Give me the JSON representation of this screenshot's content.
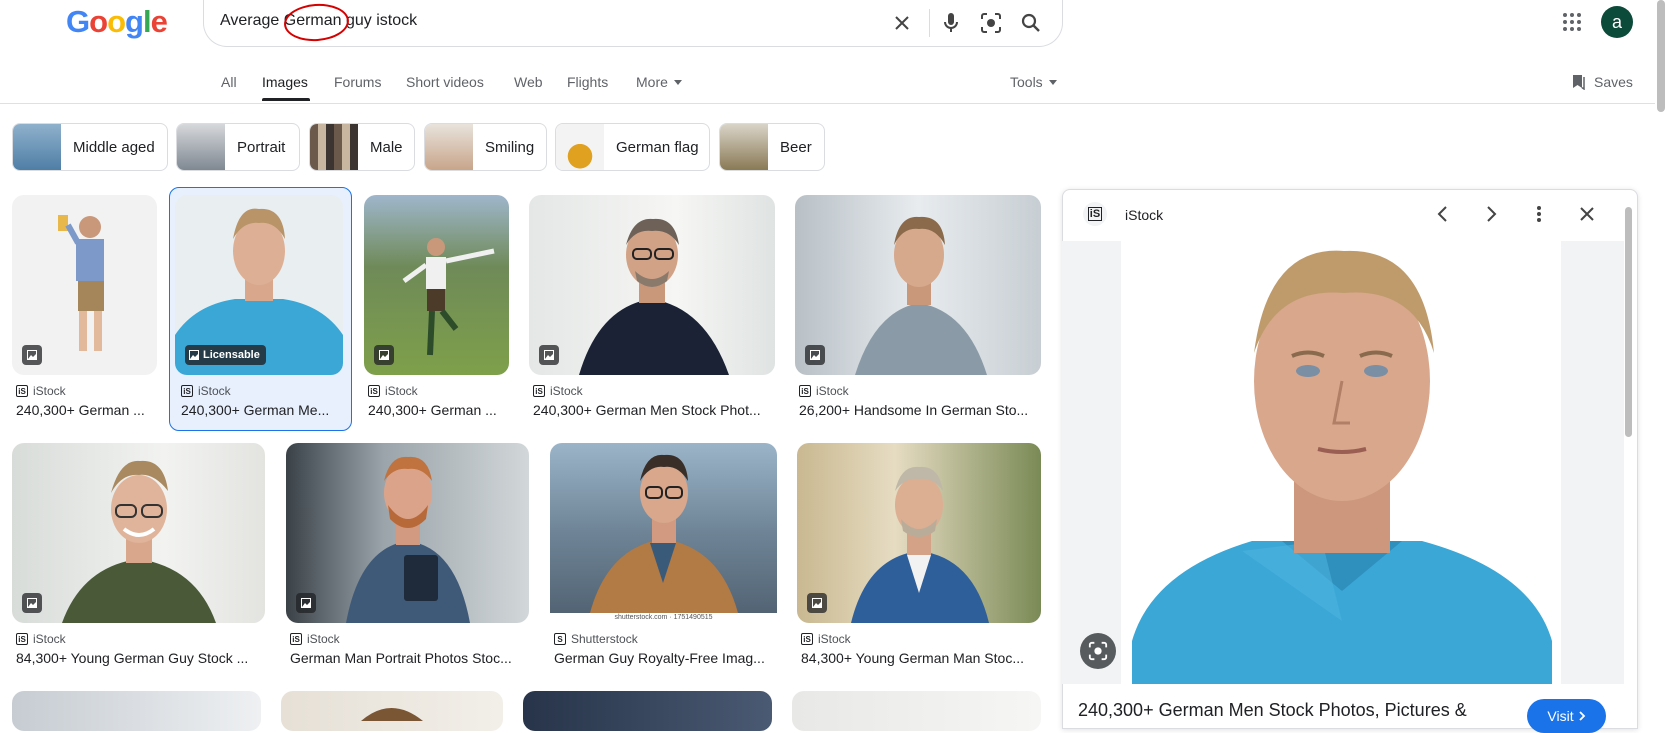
{
  "logo": {
    "letters": [
      "G",
      "o",
      "o",
      "g",
      "l",
      "e"
    ],
    "colors": [
      "#4285F4",
      "#EA4335",
      "#FBBC05",
      "#4285F4",
      "#34A853",
      "#EA4335"
    ]
  },
  "search": {
    "query": "Average German guy istock",
    "highlight_word": "German"
  },
  "account": {
    "avatar_letter": "a"
  },
  "tabs": [
    {
      "label": "All",
      "active": false
    },
    {
      "label": "Images",
      "active": true
    },
    {
      "label": "Forums",
      "active": false
    },
    {
      "label": "Short videos",
      "active": false
    },
    {
      "label": "Web",
      "active": false
    },
    {
      "label": "Flights",
      "active": false
    },
    {
      "label": "More",
      "active": false
    }
  ],
  "tools_label": "Tools",
  "saves_label": "Saves",
  "chips": [
    "Middle aged",
    "Portrait",
    "Male",
    "Smiling",
    "German flag",
    "Beer"
  ],
  "results_row1": [
    {
      "source": "iStock",
      "title": "240,300+ German ..."
    },
    {
      "source": "iStock",
      "title": "240,300+ German Me...",
      "badge": "Licensable",
      "selected": true
    },
    {
      "source": "iStock",
      "title": "240,300+ German ..."
    },
    {
      "source": "iStock",
      "title": "240,300+ German Men Stock Phot..."
    },
    {
      "source": "iStock",
      "title": "26,200+ Handsome In German Sto..."
    }
  ],
  "results_row2": [
    {
      "source": "iStock",
      "title": "84,300+ Young German Guy Stock ..."
    },
    {
      "source": "iStock",
      "title": "German Man Portrait Photos Stoc..."
    },
    {
      "source": "Shutterstock",
      "title": "German Guy Royalty-Free Imag...",
      "watermark": "shutterstock.com · 1751490515"
    },
    {
      "source": "iStock",
      "title": "84,300+ Young German Man Stoc..."
    }
  ],
  "panel": {
    "source": "iStock",
    "title": "240,300+ German Men Stock Photos, Pictures &",
    "visit_label": "Visit"
  },
  "colors": {
    "accent": "#1a73e8",
    "selected_bg": "#e8f0fe",
    "shirt_blue": "#3aa7d6"
  }
}
